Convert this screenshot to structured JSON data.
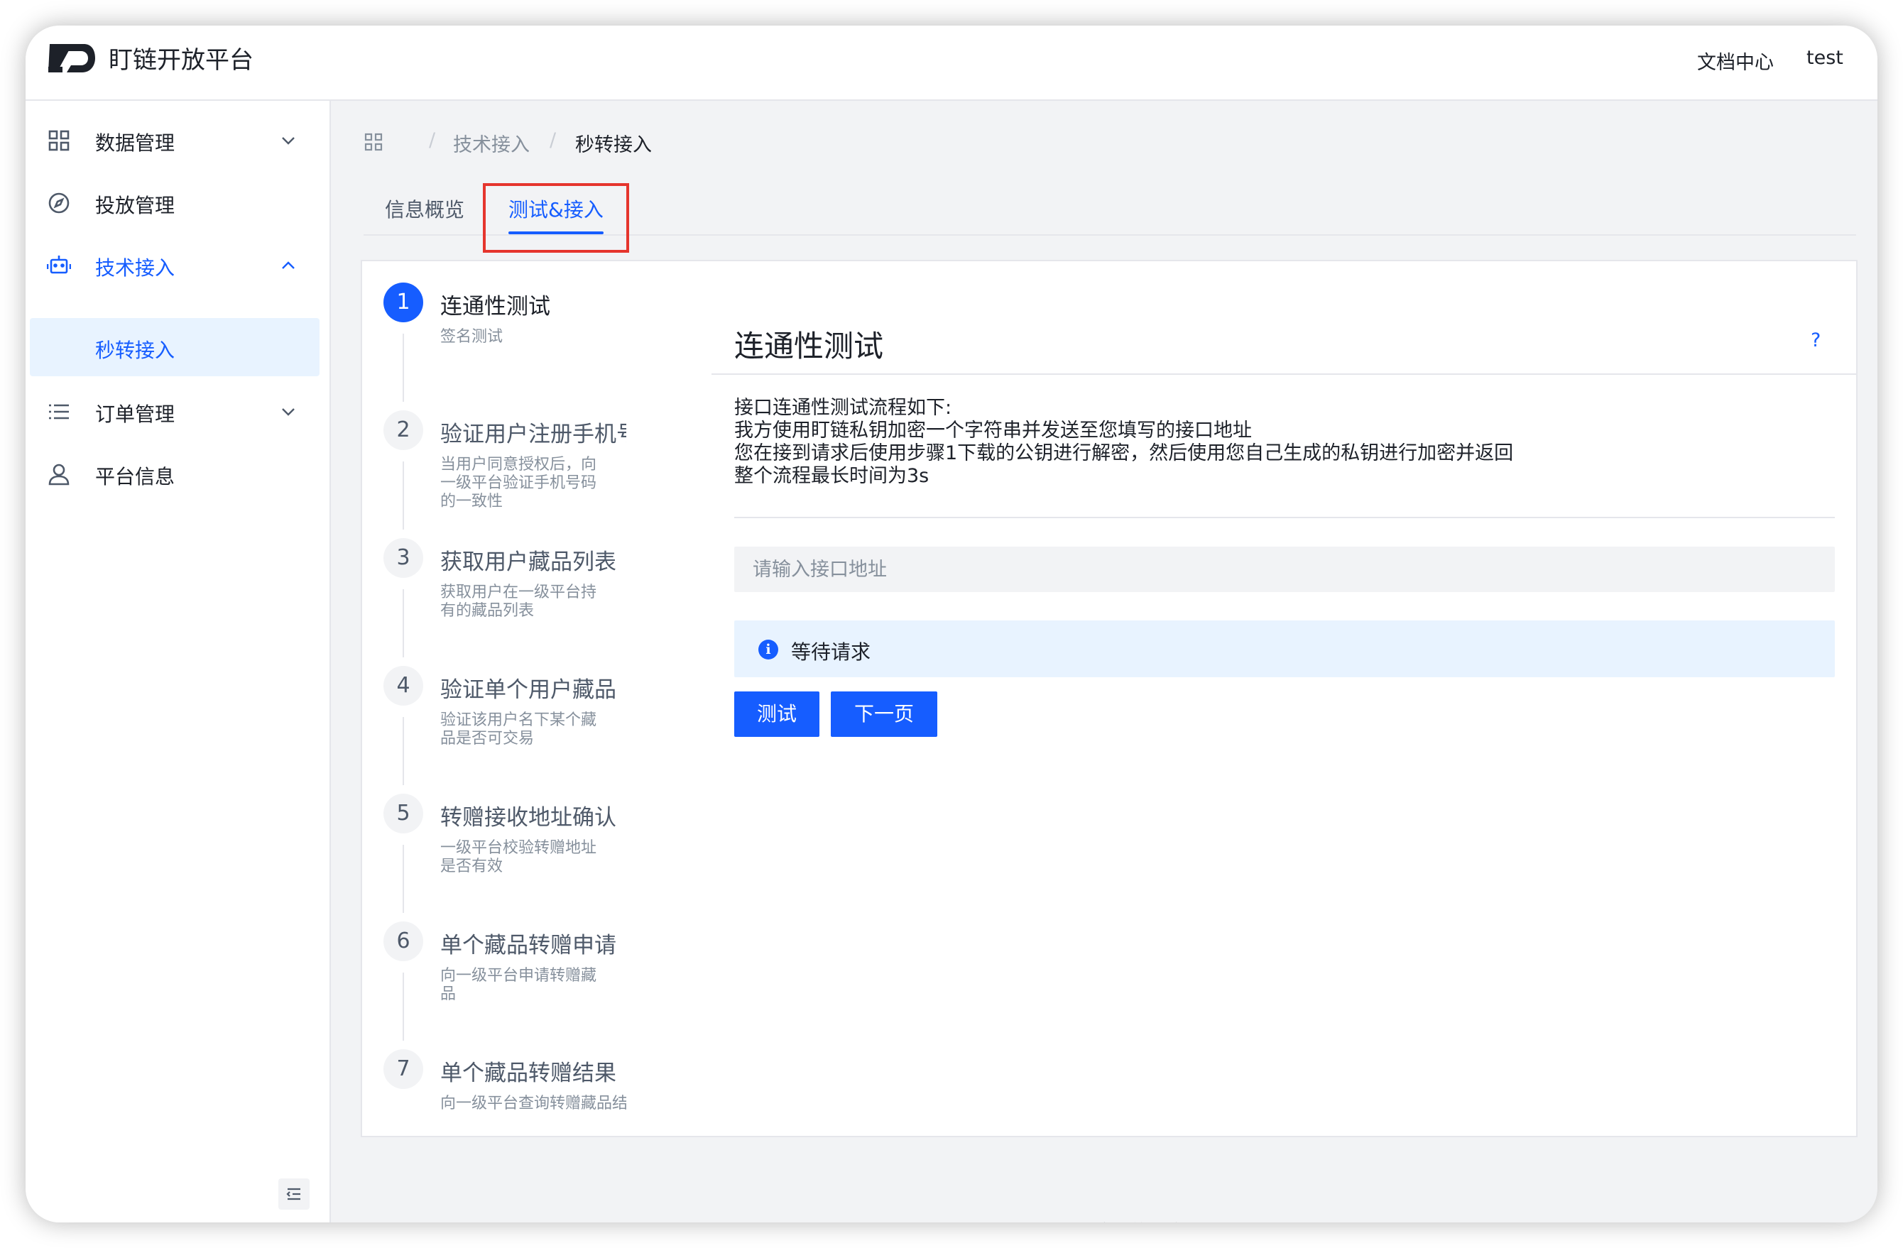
{
  "app": {
    "title": "盯链开放平台"
  },
  "header": {
    "docs_link": "文档中心",
    "user": "test"
  },
  "sidebar": {
    "items": [
      {
        "label": "数据管理",
        "icon": "grid-icon",
        "expandable": true
      },
      {
        "label": "投放管理",
        "icon": "compass-icon",
        "expandable": false
      },
      {
        "label": "技术接入",
        "icon": "robot-icon",
        "expandable": true,
        "expanded": true
      },
      {
        "label": "订单管理",
        "icon": "list-icon",
        "expandable": true
      },
      {
        "label": "平台信息",
        "icon": "user-icon",
        "expandable": false
      }
    ],
    "sub_items": [
      {
        "label": "秒转接入",
        "selected": true
      }
    ]
  },
  "breadcrumb": {
    "items": [
      "技术接入",
      "秒转接入"
    ]
  },
  "tabs": [
    {
      "label": "信息概览",
      "active": false
    },
    {
      "label": "测试&接入",
      "active": true
    }
  ],
  "steps": [
    {
      "num": "1",
      "title": "连通性测试",
      "desc": "签名测试"
    },
    {
      "num": "2",
      "title": "验证用户注册手机号",
      "desc": "当用户同意授权后，向一级平台验证手机号码的一致性"
    },
    {
      "num": "3",
      "title": "获取用户藏品列表",
      "desc": "获取用户在一级平台持有的藏品列表"
    },
    {
      "num": "4",
      "title": "验证单个用户藏品",
      "desc": "验证该用户名下某个藏品是否可交易"
    },
    {
      "num": "5",
      "title": "转赠接收地址确认",
      "desc": "一级平台校验转赠地址是否有效"
    },
    {
      "num": "6",
      "title": "单个藏品转赠申请",
      "desc": "向一级平台申请转赠藏品"
    },
    {
      "num": "7",
      "title": "单个藏品转赠结果",
      "desc": "向一级平台查询转赠藏品结果"
    }
  ],
  "content": {
    "title": "连通性测试",
    "help": "?",
    "description_lines": [
      "接口连通性测试流程如下:",
      "我方使用盯链私钥加密一个字符串并发送至您填写的接口地址",
      "您在接到请求后使用步骤1下载的公钥进行解密，然后使用您自己生成的私钥进行加密并返回",
      "整个流程最长时间为3s"
    ],
    "input_placeholder": "请输入接口地址",
    "input_value": "",
    "alert_text": "等待请求",
    "test_button": "测试",
    "next_button": "下一页"
  },
  "footer": {
    "text": "盯链开放平台"
  },
  "colors": {
    "primary": "#165dff",
    "highlight_border": "#e5352d",
    "selected_bg": "#e8f3ff"
  }
}
